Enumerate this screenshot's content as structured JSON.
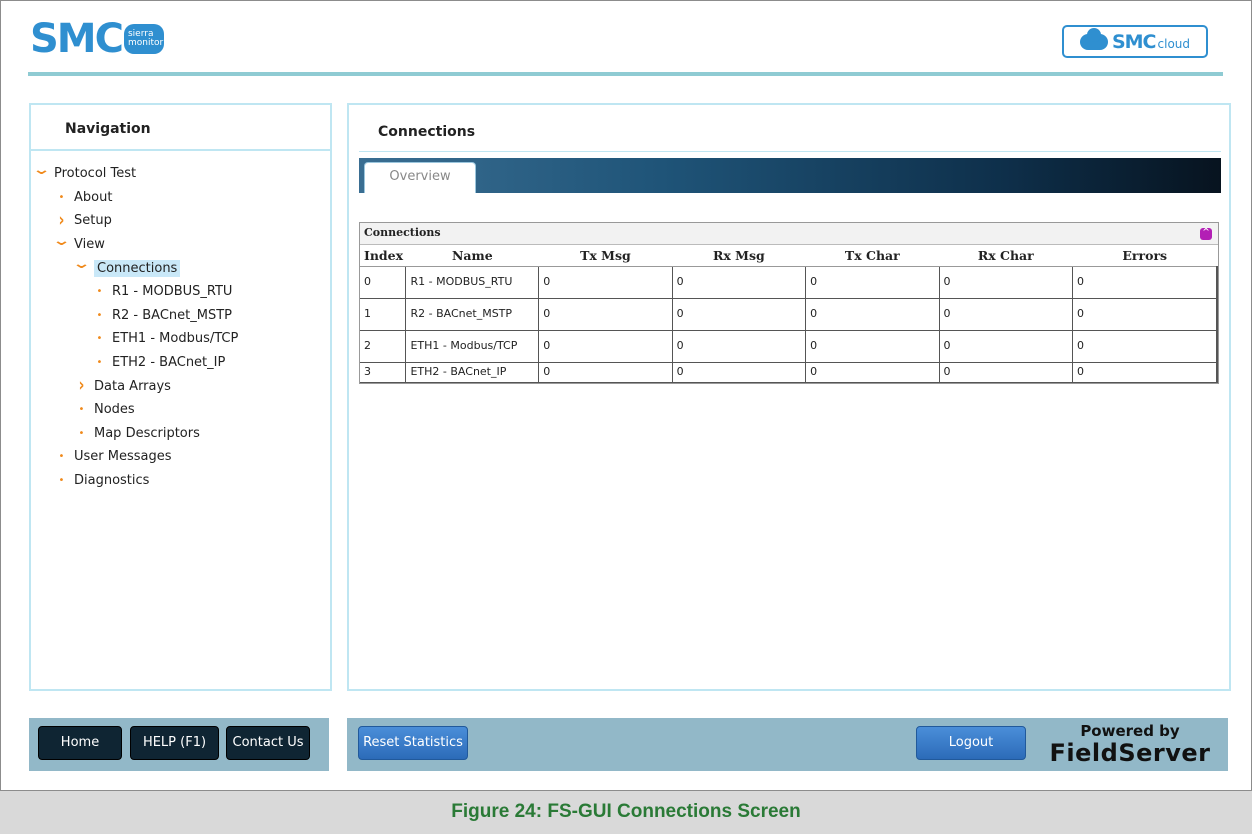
{
  "header": {
    "logo_main": "SMC",
    "logo_sub": "sierra monitor",
    "cloud_main": "SMC",
    "cloud_sub": "cloud"
  },
  "navigation": {
    "title": "Navigation",
    "items": [
      {
        "label": "Protocol Test",
        "level": 0,
        "marker": "expanded"
      },
      {
        "label": "About",
        "level": 1,
        "marker": "bullet"
      },
      {
        "label": "Setup",
        "level": 1,
        "marker": "collapsed"
      },
      {
        "label": "View",
        "level": 1,
        "marker": "expanded"
      },
      {
        "label": "Connections",
        "level": 2,
        "marker": "expanded",
        "selected": true
      },
      {
        "label": "R1 - MODBUS_RTU",
        "level": 3,
        "marker": "bullet"
      },
      {
        "label": "R2 - BACnet_MSTP",
        "level": 3,
        "marker": "bullet"
      },
      {
        "label": "ETH1 - Modbus/TCP",
        "level": 3,
        "marker": "bullet"
      },
      {
        "label": "ETH2 - BACnet_IP",
        "level": 3,
        "marker": "bullet"
      },
      {
        "label": "Data Arrays",
        "level": 2,
        "marker": "collapsed"
      },
      {
        "label": "Nodes",
        "level": 2,
        "marker": "bullet"
      },
      {
        "label": "Map Descriptors",
        "level": 2,
        "marker": "bullet"
      },
      {
        "label": "User Messages",
        "level": 1,
        "marker": "bullet"
      },
      {
        "label": "Diagnostics",
        "level": 1,
        "marker": "bullet"
      }
    ]
  },
  "content": {
    "title": "Connections",
    "tabs": [
      {
        "label": "Overview",
        "active": true
      }
    ],
    "table": {
      "caption": "Connections",
      "columns": [
        "Index",
        "Name",
        "Tx Msg",
        "Rx Msg",
        "Tx Char",
        "Rx Char",
        "Errors"
      ],
      "rows": [
        [
          "0",
          "R1 - MODBUS_RTU",
          "0",
          "0",
          "0",
          "0",
          "0"
        ],
        [
          "1",
          "R2 - BACnet_MSTP",
          "0",
          "0",
          "0",
          "0",
          "0"
        ],
        [
          "2",
          "ETH1 - Modbus/TCP",
          "0",
          "0",
          "0",
          "0",
          "0"
        ],
        [
          "3",
          "ETH2 - BACnet_IP",
          "0",
          "0",
          "0",
          "0",
          "0"
        ]
      ]
    }
  },
  "footer": {
    "home_label": "Home",
    "help_label": "HELP (F1)",
    "contact_label": "Contact Us",
    "reset_label": "Reset Statistics",
    "logout_label": "Logout",
    "powered_by": "Powered by",
    "powered_brand": "FieldServer"
  },
  "caption": "Figure 24: FS-GUI Connections Screen",
  "colors": {
    "accent": "#2f8fd0",
    "tree_marker": "#f08a1c",
    "panel_border": "#bfe6f2",
    "footer_bar": "#92b8c8",
    "caption_text": "#2a7a36"
  }
}
